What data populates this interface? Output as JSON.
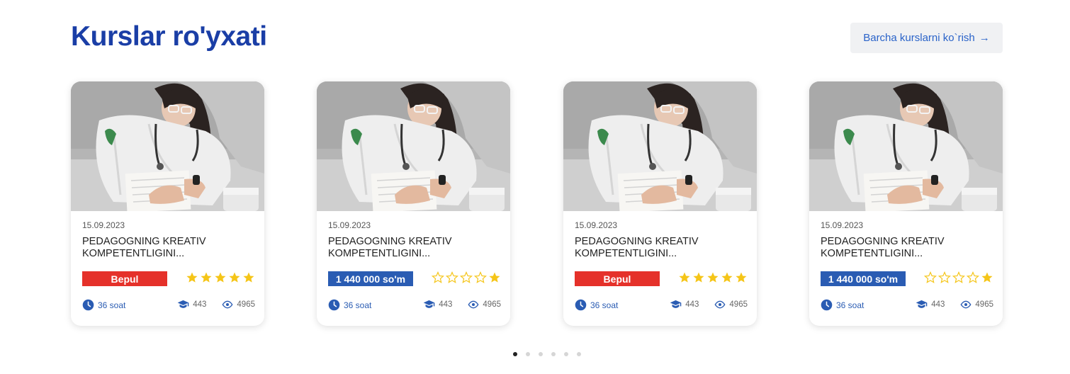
{
  "header": {
    "title": "Kurslar ro'yxati",
    "see_all_label": "Barcha kurslarni ko`rish",
    "see_all_arrow": "→"
  },
  "colors": {
    "accent": "#1a3ea6",
    "free": "#e5312a",
    "paid": "#2a5cb3",
    "star": "#f5c518"
  },
  "courses": [
    {
      "date": "15.09.2023",
      "title": "PEDAGOGNING KREATIV KOMPETENTLIGINI...",
      "price": "Bepul",
      "price_type": "free",
      "rating": 5,
      "duration": "36 soat",
      "students": "443",
      "views": "4965"
    },
    {
      "date": "15.09.2023",
      "title": "PEDAGOGNING KREATIV KOMPETENTLIGINI...",
      "price": "1 440 000 so'm",
      "price_type": "paid",
      "rating": 1,
      "duration": "36 soat",
      "students": "443",
      "views": "4965"
    },
    {
      "date": "15.09.2023",
      "title": "PEDAGOGNING KREATIV KOMPETENTLIGINI...",
      "price": "Bepul",
      "price_type": "free",
      "rating": 5,
      "duration": "36 soat",
      "students": "443",
      "views": "4965"
    },
    {
      "date": "15.09.2023",
      "title": "PEDAGOGNING KREATIV KOMPETENTLIGINI...",
      "price": "1 440 000 so'm",
      "price_type": "paid",
      "rating": 1,
      "duration": "36 soat",
      "students": "443",
      "views": "4965"
    }
  ],
  "pagination": {
    "count": 6,
    "active": 0
  }
}
